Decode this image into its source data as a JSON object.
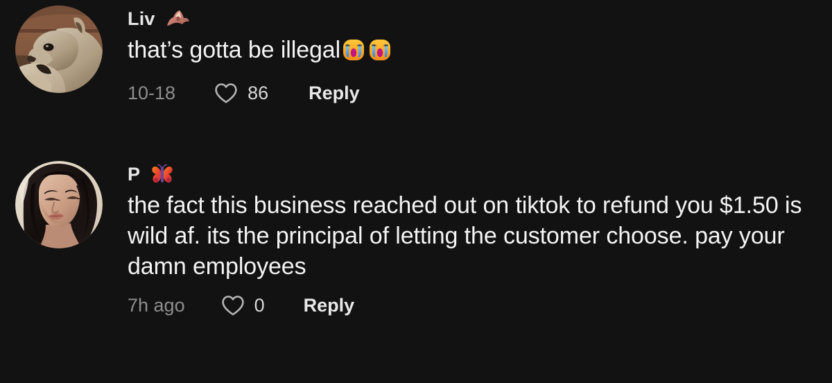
{
  "theme": {
    "background": "#121212",
    "text_primary": "#f4f4f4",
    "text_username": "#e8e8e8",
    "text_muted": "#8e8e8e",
    "heart_outline": "#b5b5b5",
    "like_count": "#d8d8d8"
  },
  "comments": [
    {
      "avatar": {
        "name": "wolf-pup-photo",
        "alt": "photo of a wolf pup resting",
        "colors": [
          "#8a6a52",
          "#cbbba4",
          "#d9cbb4",
          "#4a3a2c",
          "#6d5640"
        ]
      },
      "username": "Liv",
      "username_emoji": {
        "name": "bat-emoji",
        "glyph": "🦇",
        "colors": [
          "#b5736a",
          "#d9938a",
          "#e8b5a0"
        ]
      },
      "text": "that’s gotta be illegal",
      "text_emojis": [
        {
          "name": "loudly-crying-face-emoji",
          "glyph": "😭"
        },
        {
          "name": "loudly-crying-face-emoji",
          "glyph": "😭"
        }
      ],
      "date": "10-18",
      "like_count": "86",
      "reply_label": "Reply"
    },
    {
      "avatar": {
        "name": "person-portrait-photo",
        "alt": "portrait of a person with long dark hair",
        "colors": [
          "#efe4d4",
          "#1a1412",
          "#d6ab93",
          "#b07f68",
          "#2b1f1b"
        ]
      },
      "username": "P",
      "username_emoji": {
        "name": "butterfly-emoji",
        "glyph": "🦋",
        "colors": [
          "#f05a28",
          "#e0353f",
          "#7b4a9c"
        ]
      },
      "text": "the fact this business reached out on tiktok to refund you $1.50 is wild af. its the principal of letting the customer choose. pay your damn employees",
      "text_emojis": [],
      "date": "7h ago",
      "like_count": "0",
      "reply_label": "Reply"
    }
  ]
}
